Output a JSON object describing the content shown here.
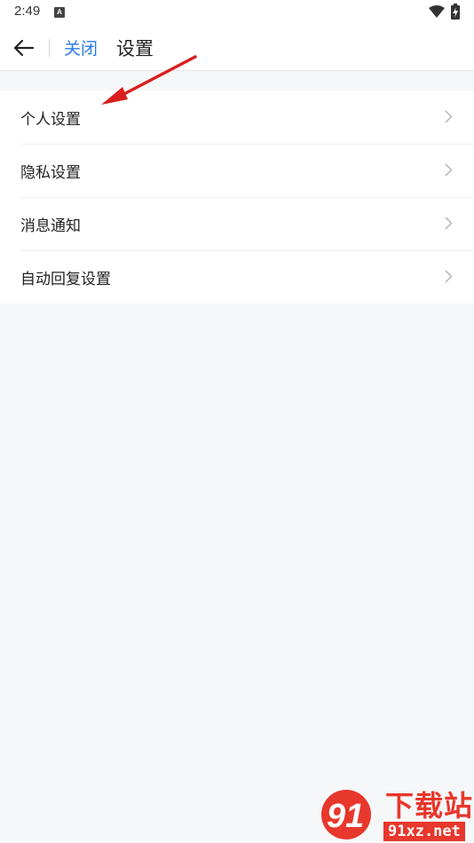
{
  "status_bar": {
    "time": "2:49",
    "notification_icon": "a-icon",
    "wifi_icon": "wifi-icon",
    "battery_icon": "battery-charging-icon"
  },
  "nav": {
    "back_icon": "arrow-left-icon",
    "close_label": "关闭",
    "title": "设置"
  },
  "settings": {
    "items": [
      {
        "label": "个人设置"
      },
      {
        "label": "隐私设置"
      },
      {
        "label": "消息通知"
      },
      {
        "label": "自动回复设置"
      }
    ]
  },
  "annotation": {
    "arrow_icon": "red-arrow-annotation",
    "color": "#d9201f"
  },
  "watermark": {
    "logo_text": "91",
    "title": "下载站",
    "domain": "91xz.net",
    "color": "#e8372c"
  },
  "colors": {
    "accent": "#2b7be6",
    "background": "#f6f7f9"
  }
}
